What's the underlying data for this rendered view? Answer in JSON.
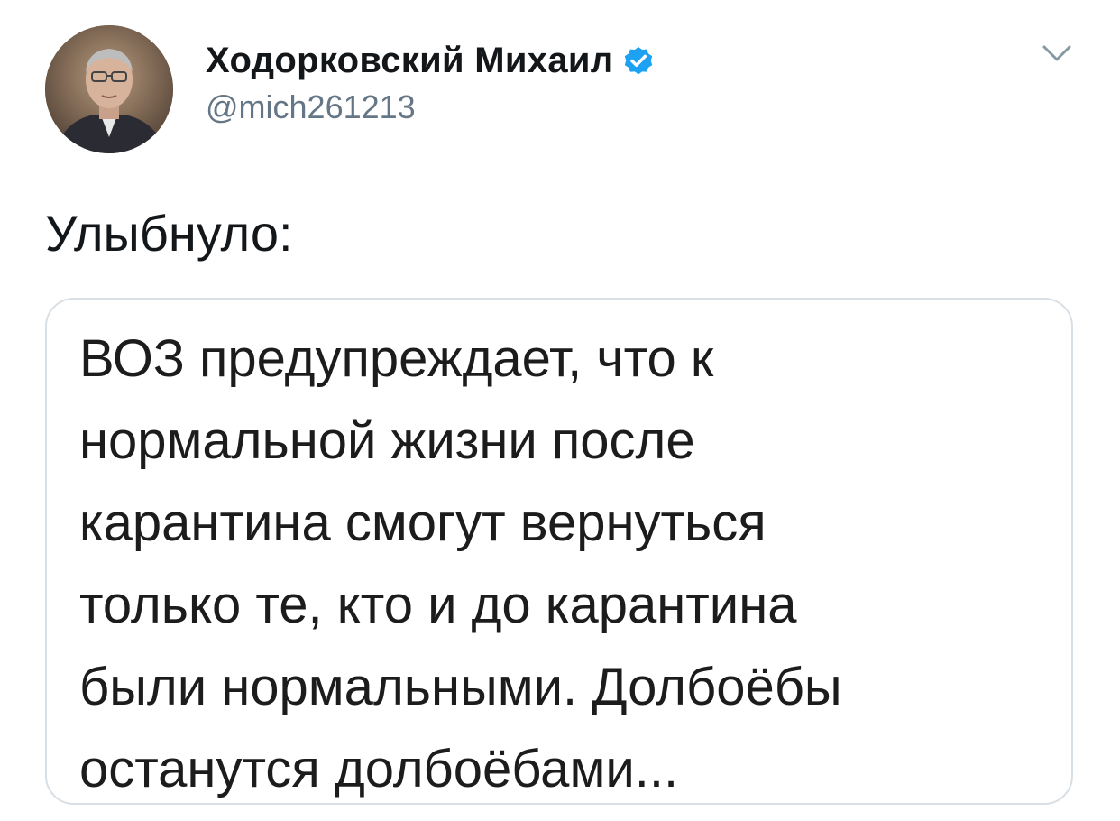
{
  "author": {
    "display_name": "Ходорковский Михаил",
    "handle": "@mich261213",
    "verified": true,
    "avatar_icon": "user-avatar"
  },
  "menu": {
    "icon": "chevron-down-icon"
  },
  "tweet": {
    "text": "Улыбнуло:"
  },
  "media": {
    "lines": [
      "ВОЗ предупреждает, что к",
      "нормальной жизни после",
      "карантина смогут вернуться",
      "только те, кто и до карантина",
      "были нормальными. Долбоёбы",
      "останутся долбоёбами..."
    ]
  },
  "colors": {
    "verified_badge": "#1da1f2",
    "handle": "#657786",
    "border": "#d8dfe5",
    "chevron": "#8899a6"
  }
}
